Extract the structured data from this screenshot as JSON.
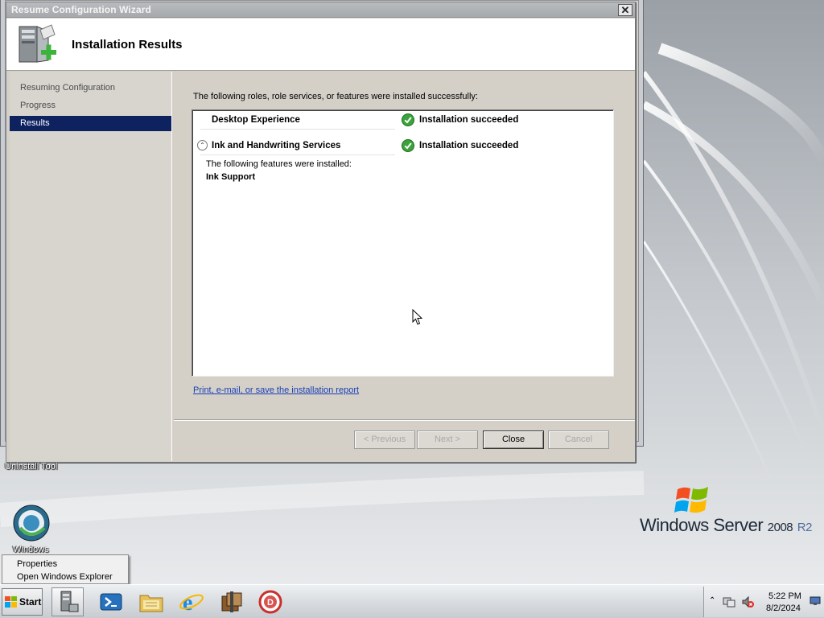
{
  "window": {
    "title": "Resume Configuration Wizard",
    "close_glyph": "✕",
    "header_title": "Installation Results"
  },
  "nav": {
    "items": [
      {
        "label": "Resuming Configuration",
        "active": false
      },
      {
        "label": "Progress",
        "active": false
      },
      {
        "label": "Results",
        "active": true
      }
    ]
  },
  "content": {
    "intro": "The following roles, role services, or features were installed successfully:",
    "results": [
      {
        "name": "Desktop Experience",
        "status": "Installation succeeded",
        "status_icon": "green-check-icon"
      },
      {
        "name": "Ink and Handwriting Services",
        "status": "Installation succeeded",
        "status_icon": "green-check-icon",
        "expander": "collapse-icon"
      }
    ],
    "detail_intro": "The following features were installed:",
    "detail_item": "Ink Support",
    "report_link": "Print, e-mail, or save the installation report"
  },
  "buttons": {
    "previous": "< Previous",
    "next": "Next >",
    "close": "Close",
    "cancel": "Cancel"
  },
  "desktop": {
    "uninstall_label": "Uninstall Tool",
    "windows_icon_label": "Windows",
    "logo_main": "Windows Server",
    "logo_year": "2008",
    "logo_edition": "R2"
  },
  "context_menu": {
    "items": [
      "Properties",
      "Open Windows Explorer"
    ]
  },
  "taskbar": {
    "start_label": "Start",
    "icons": [
      "server-manager-icon",
      "powershell-icon",
      "explorer-folder-icon",
      "internet-explorer-icon",
      "archive-tool-icon",
      "uninstall-tool-icon"
    ],
    "clock_time": "5:22 PM",
    "clock_date": "8/2/2024"
  }
}
